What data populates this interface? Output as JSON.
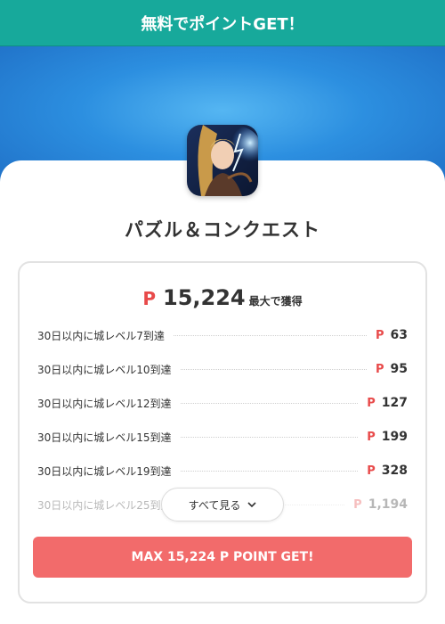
{
  "header": {
    "title": "無料でポイントGET！"
  },
  "app": {
    "name": "パズル＆コンクエスト",
    "icon": "fantasy-archer-app-icon"
  },
  "total": {
    "currency": "P",
    "amount": "15,224",
    "suffix": "最大で獲得"
  },
  "rewards": [
    {
      "label": "30日以内に城レベル7到達",
      "currency": "P",
      "points": "63"
    },
    {
      "label": "30日以内に城レベル10到達",
      "currency": "P",
      "points": "95"
    },
    {
      "label": "30日以内に城レベル12到達",
      "currency": "P",
      "points": "127"
    },
    {
      "label": "30日以内に城レベル15到達",
      "currency": "P",
      "points": "199"
    },
    {
      "label": "30日以内に城レベル19到達",
      "currency": "P",
      "points": "328"
    },
    {
      "label": "30日以内に城レベル25到達",
      "currency": "P",
      "points": "1,194"
    }
  ],
  "see_all": {
    "label": "すべて見る",
    "icon": "chevron-down-icon"
  },
  "cta": {
    "label": "MAX 15,224 P POINT GET!"
  },
  "colors": {
    "header": "#17a99b",
    "accent": "#e84a4a",
    "cta": "#f26b6b",
    "hero": "#2c8fe0"
  }
}
